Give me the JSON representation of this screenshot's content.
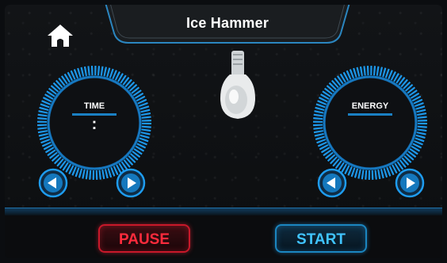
{
  "header": {
    "title": "Ice Hammer"
  },
  "time_dial": {
    "label": "TIME",
    "value": ":"
  },
  "energy_dial": {
    "label": "ENERGY",
    "value": ""
  },
  "controls": {
    "pause_label": "PAUSE",
    "start_label": "START"
  },
  "icons": {
    "home": "home-icon",
    "left_arrow": "left-arrow-icon",
    "right_arrow": "right-arrow-icon",
    "handpiece": "ice-hammer-handpiece"
  },
  "colors": {
    "accent_blue": "#1e9cf0",
    "pause_red": "#ff2b3c",
    "start_blue": "#40c4ff"
  }
}
